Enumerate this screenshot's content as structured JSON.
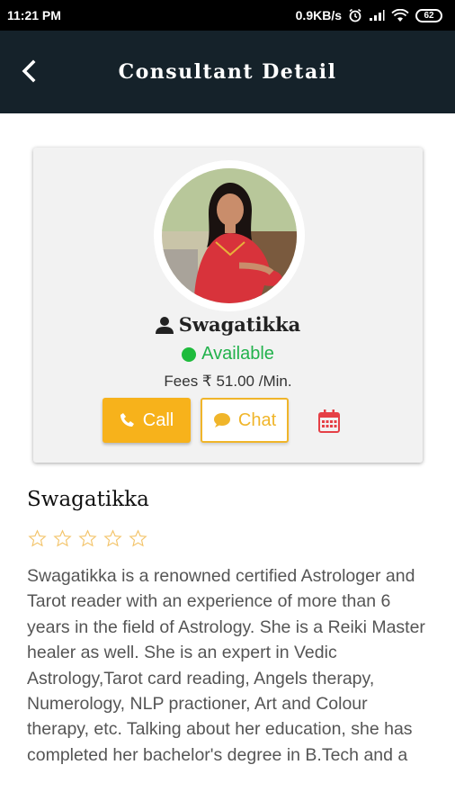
{
  "status_bar": {
    "time": "11:21 PM",
    "network_speed": "0.9KB/s",
    "battery": "62"
  },
  "app_bar": {
    "title": "Consultant Detail",
    "back_icon": "back-arrow-icon"
  },
  "consultant": {
    "name": "Swagatikka",
    "status": "Available",
    "fees": "Fees ₹ 51.00 /Min.",
    "rating_stars": 0,
    "rating_max": 5
  },
  "actions": {
    "call_label": "Call",
    "chat_label": "Chat",
    "accent_color": "#f7b21b"
  },
  "about": {
    "heading": "Swagatikka",
    "bio": "Swagatikka is a renowned certified Astrologer and Tarot reader with an experience of more than 6 years in the field of Astrology. She is a Reiki Master healer as well. She is an expert in Vedic Astrology,Tarot card reading, Angels therapy, Numerology, NLP practioner, Art and Colour therapy, etc. Talking about her education, she has completed her bachelor's degree in B.Tech and a"
  }
}
